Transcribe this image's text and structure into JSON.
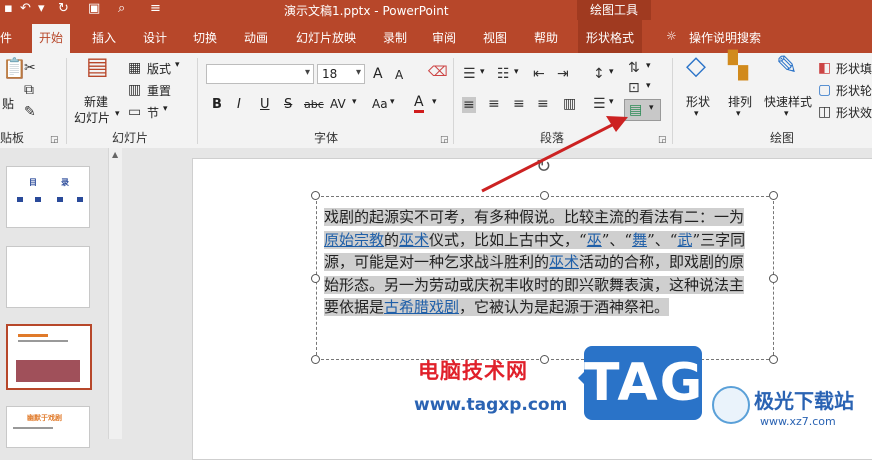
{
  "window": {
    "title": "演示文稿1.pptx  -  PowerPoint",
    "context_tools": "绘图工具",
    "qat": {
      "undo_icon": "undo-icon",
      "redo_icon": "redo-icon",
      "more": "▾"
    }
  },
  "tabs": [
    "件",
    "开始",
    "插入",
    "设计",
    "切换",
    "动画",
    "幻灯片放映",
    "录制",
    "审阅",
    "视图",
    "帮助",
    "形状格式",
    "操作说明搜索"
  ],
  "ribbon": {
    "clipboard": {
      "paste": "贴",
      "label": "贴板"
    },
    "slides": {
      "new_slide": "新建",
      "new_slide2": "幻灯片",
      "layout": "版式",
      "reset": "重置",
      "section": "节",
      "label": "幻灯片"
    },
    "font": {
      "font_name": "",
      "font_size": "18",
      "bold": "B",
      "italic": "I",
      "underline": "U",
      "strike": "S",
      "shadow": "abc",
      "spacing": "AV",
      "case": "Aa",
      "color": "A",
      "grow": "A",
      "shrink": "A",
      "label": "字体"
    },
    "paragraph": {
      "label": "段落"
    },
    "drawing": {
      "shapes": "形状",
      "arrange": "排列",
      "quick_styles": "快速样式",
      "fill": "形状填",
      "outline": "形状轮",
      "effects": "形状效",
      "label": "绘图"
    }
  },
  "slide": {
    "segments": [
      {
        "t": "戏剧的起源实不可考，有多种假说。比较主流的看法有二：一为",
        "link": false
      },
      {
        "t": "原始宗教",
        "link": true
      },
      {
        "t": "的",
        "link": false
      },
      {
        "t": "巫术",
        "link": true
      },
      {
        "t": "仪式，比如上古中文，“",
        "link": false
      },
      {
        "t": "巫",
        "link": true
      },
      {
        "t": "”、“",
        "link": false
      },
      {
        "t": "舞",
        "link": true
      },
      {
        "t": "”、“",
        "link": false
      },
      {
        "t": "武",
        "link": true
      },
      {
        "t": "”三字同源，可能是对一种乞求战斗胜利的",
        "link": false
      },
      {
        "t": "巫术",
        "link": true
      },
      {
        "t": "活动的合称，即戏剧的原始形态。另一为劳动或庆祝丰收时的即兴歌舞表演，这种说法主要依据是",
        "link": false
      },
      {
        "t": "古希腊戏剧",
        "link": true
      },
      {
        "t": "，它被认为是起源于酒神祭祀。",
        "link": false
      }
    ]
  },
  "thumbs": {
    "t1_a": "目",
    "t1_b": "录",
    "t3_title": "幻灯片",
    "t4_title": "幽默于戏剧"
  },
  "watermark": {
    "site_cn": "电脑技术网",
    "url": "www.tagxp.com",
    "tag": "TAG",
    "jg_cn": "极光下载站",
    "jg_url": "www.xz7.com"
  },
  "colors": {
    "accent": "#b7472a",
    "link": "#1f5fa8",
    "arrow": "#cc2222"
  }
}
